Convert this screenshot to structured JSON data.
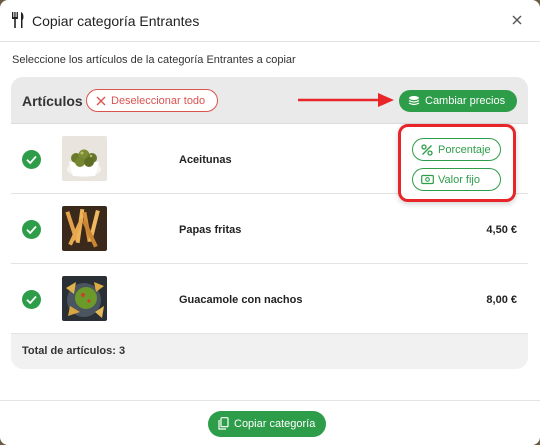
{
  "modal": {
    "title": "Copiar categoría Entrantes",
    "subtitle": "Seleccione los artículos de la categoría Entrantes a copiar",
    "close_icon": "close-icon"
  },
  "panel": {
    "heading": "Artículos",
    "deselect_label": "Deseleccionar todo",
    "change_prices_label": "Cambiar precios",
    "total_label": "Total de artículos: 3"
  },
  "popover": {
    "percentage_label": "Porcentaje",
    "fixed_value_label": "Valor fijo"
  },
  "items": [
    {
      "name": "Aceitunas",
      "price": "",
      "selected": true,
      "image": "olives"
    },
    {
      "name": "Papas fritas",
      "price": "4,50 €",
      "selected": true,
      "image": "fries"
    },
    {
      "name": "Guacamole con nachos",
      "price": "8,00 €",
      "selected": true,
      "image": "guacamole"
    }
  ],
  "footer": {
    "copy_label": "Copiar categoría"
  },
  "colors": {
    "accent_green": "#2e9d4a",
    "danger_red": "#d9534f",
    "annotation_red": "#e8262a"
  }
}
